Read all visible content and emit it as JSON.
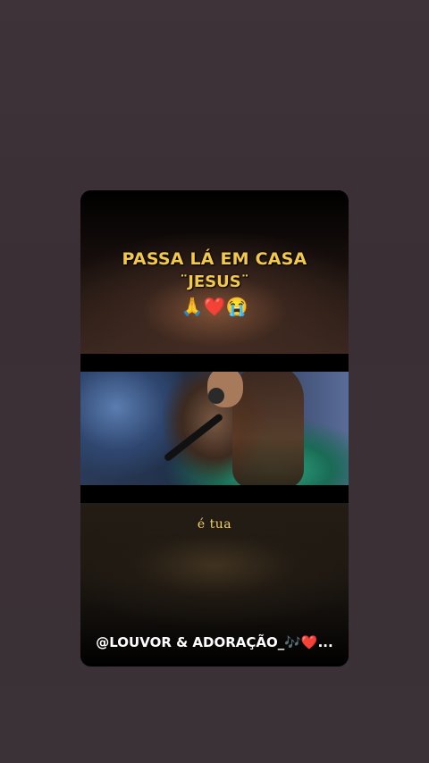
{
  "story": {
    "title_line_1": "PASSA LÁ EM CASA",
    "title_line_2": "¨JESUS¨",
    "emojis": "🙏❤️😭",
    "lyric": "é tua",
    "caption_text": "@LOUVOR & ADORAÇÃO_🎶",
    "caption_heart": "❤️",
    "caption_ellipsis": "..."
  },
  "colors": {
    "title": "#f2c94c",
    "lyric": "#f2d36b",
    "caption": "#ffffff",
    "background": "#3a2f35"
  },
  "media": {
    "video_icon": "singer-video-frame"
  }
}
